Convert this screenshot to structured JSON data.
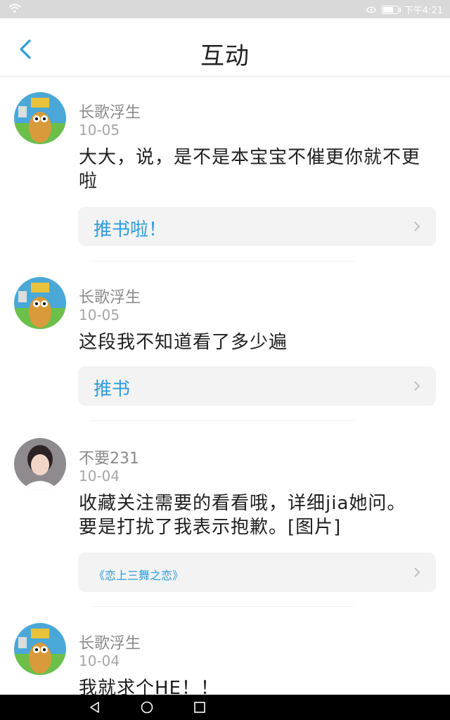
{
  "status_bar": {
    "time": "下午4:21"
  },
  "header": {
    "title": "互动"
  },
  "feed": [
    {
      "username": "长歌浮生",
      "date": "10-05",
      "content": "大大，说，是不是本宝宝不催更你就不更啦",
      "book": "推书啦！"
    },
    {
      "username": "长歌浮生",
      "date": "10-05",
      "content": "这段我不知道看了多少遍",
      "book": "推书"
    },
    {
      "username": "不要231",
      "date": "10-04",
      "content": "收藏关注需要的看看哦，详细jia她问。要是打扰了我表示抱歉。[图片]",
      "book": "《恋上三舞之恋》"
    },
    {
      "username": "长歌浮生",
      "date": "10-04",
      "content": "我就求个HE！！"
    }
  ],
  "colors": {
    "accent": "#2d9cdb",
    "username": "#8a8a8a",
    "date": "#a6a6a6"
  },
  "icons": [
    "wifi-icon",
    "eye-icon",
    "battery-icon",
    "back-arrow-icon",
    "chevron-right-icon",
    "nav-back-icon",
    "nav-home-icon",
    "nav-recents-icon"
  ]
}
